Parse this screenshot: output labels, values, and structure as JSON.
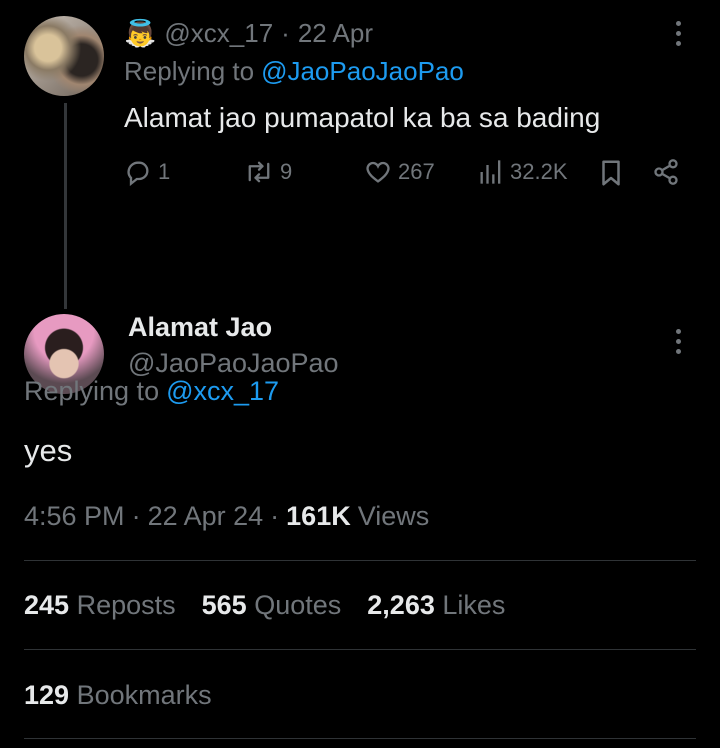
{
  "parent_tweet": {
    "emoji": "👼",
    "handle": "@xcx_17",
    "separator": "·",
    "date": "22 Apr",
    "replying_prefix": "Replying to",
    "replying_handle": "@JaoPaoJaoPao",
    "text": "Alamat jao pumapatol ka ba sa bading",
    "actions": {
      "replies": "1",
      "reposts": "9",
      "likes": "267",
      "views": "32.2K"
    }
  },
  "main_tweet": {
    "display_name": "Alamat Jao",
    "handle": "@JaoPaoJaoPao",
    "replying_prefix": "Replying to",
    "replying_handle": "@xcx_17",
    "text": "yes",
    "time": "4:56 PM",
    "sep1": "·",
    "date": "22 Apr 24",
    "sep2": "·",
    "views_count": "161K",
    "views_label": "Views"
  },
  "stats": {
    "reposts_count": "245",
    "reposts_label": "Reposts",
    "quotes_count": "565",
    "quotes_label": "Quotes",
    "likes_count": "2,263",
    "likes_label": "Likes",
    "bookmarks_count": "129",
    "bookmarks_label": "Bookmarks"
  },
  "colors": {
    "background": "#000000",
    "text": "#e7e9ea",
    "muted": "#71767b",
    "link": "#1d9bf0",
    "divider": "#2f3336"
  }
}
